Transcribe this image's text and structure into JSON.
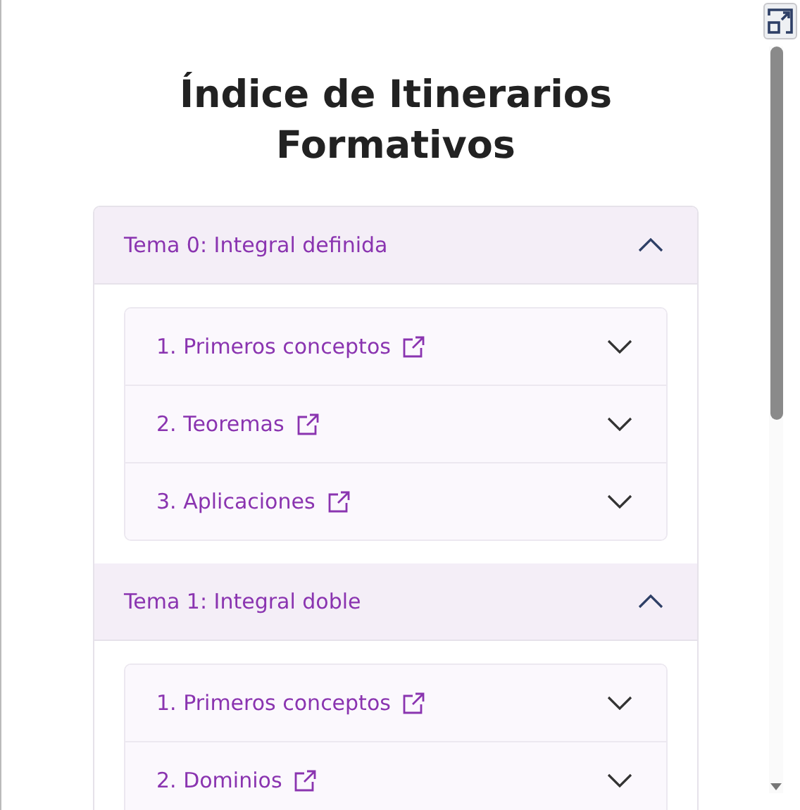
{
  "title": "Índice de Itinerarios Formativos",
  "topics": [
    {
      "label": "Tema 0: Integral definida",
      "expanded": true,
      "items": [
        {
          "label": "1. Primeros conceptos",
          "expanded": false
        },
        {
          "label": "2. Teoremas",
          "expanded": false
        },
        {
          "label": "3. Aplicaciones",
          "expanded": false
        }
      ]
    },
    {
      "label": "Tema 1: Integral doble",
      "expanded": true,
      "items": [
        {
          "label": "1. Primeros conceptos",
          "expanded": false
        },
        {
          "label": "2. Dominios",
          "expanded": false
        }
      ]
    }
  ]
}
